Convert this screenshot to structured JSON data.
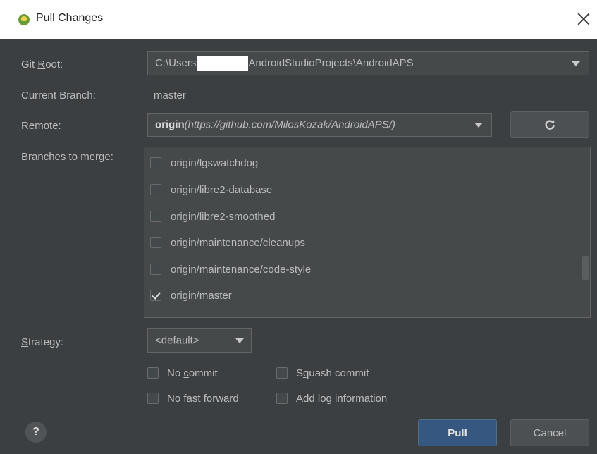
{
  "window": {
    "title": "Pull Changes"
  },
  "git_root": {
    "label_pre": "Git ",
    "label_mn": "R",
    "label_post": "oot:",
    "value_pre": "C:\\Users",
    "value_post": "AndroidStudioProjects\\AndroidAPS"
  },
  "current_branch": {
    "label": "Current Branch:",
    "value": "master"
  },
  "remote": {
    "label_pre": "Re",
    "label_mn": "m",
    "label_post": "ote:",
    "name": "origin",
    "url": "(https://github.com/MilosKozak/AndroidAPS/)"
  },
  "branches": {
    "label_mn": "B",
    "label_post": "ranches to merge:",
    "items": [
      {
        "label": "origin/lgswatchdog",
        "checked": false
      },
      {
        "label": "origin/libre2-database",
        "checked": false
      },
      {
        "label": "origin/libre2-smoothed",
        "checked": false
      },
      {
        "label": "origin/maintenance/cleanups",
        "checked": false
      },
      {
        "label": "origin/maintenance/code-style",
        "checked": false
      },
      {
        "label": "origin/master",
        "checked": true
      }
    ]
  },
  "strategy": {
    "label_mn": "S",
    "label_post": "trategy:",
    "value": "<default>"
  },
  "options": {
    "no_commit": {
      "pre": "No ",
      "mn": "c",
      "post": "ommit",
      "checked": false
    },
    "squash_commit": {
      "pre": "S",
      "mn": "q",
      "post": "uash commit",
      "checked": false
    },
    "no_fast_forward": {
      "pre": "No ",
      "mn": "f",
      "post": "ast forward",
      "checked": false
    },
    "add_log": {
      "pre": "Add ",
      "mn": "l",
      "post": "og information",
      "checked": false
    }
  },
  "buttons": {
    "help": "?",
    "pull": "Pull",
    "cancel": "Cancel"
  }
}
